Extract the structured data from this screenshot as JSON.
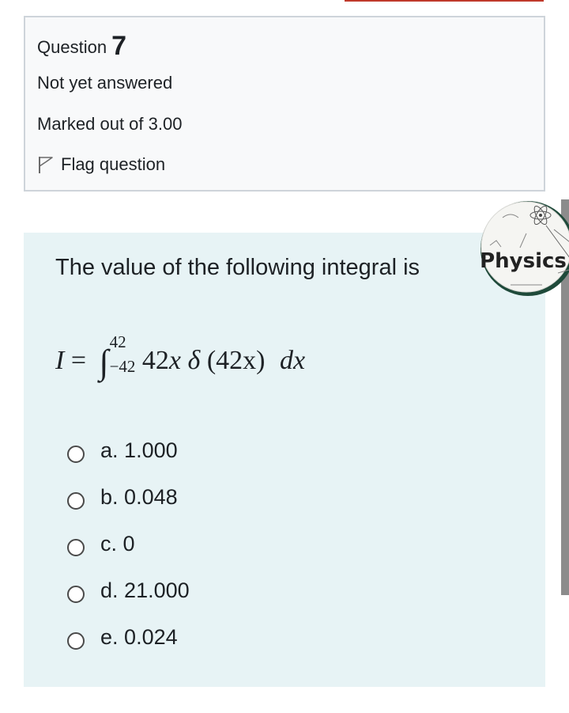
{
  "info": {
    "question_word": "Question",
    "question_number": "7",
    "state": "Not yet answered",
    "grade": "Marked out of 3.00",
    "flag_label": "Flag question"
  },
  "question": {
    "text": "The value of the following integral is",
    "formula": {
      "lhs": "I",
      "equals": "=",
      "integral_sign": "∫",
      "upper_limit": "42",
      "lower_limit": "−42",
      "integrand_coef": "42",
      "integrand_var": "x",
      "delta": "δ",
      "delta_arg": "(42x)",
      "differential": "dx"
    }
  },
  "options": [
    {
      "letter": "a.",
      "value": "1.000"
    },
    {
      "letter": "b.",
      "value": "0.048"
    },
    {
      "letter": "c.",
      "value": "0"
    },
    {
      "letter": "d.",
      "value": "21.000"
    },
    {
      "letter": "e.",
      "value": "0.024"
    }
  ],
  "logo": {
    "text": "Physics"
  },
  "colors": {
    "content_bg": "#e7f3f5",
    "info_bg": "#f8f9fa",
    "accent_red": "#c0392b"
  }
}
